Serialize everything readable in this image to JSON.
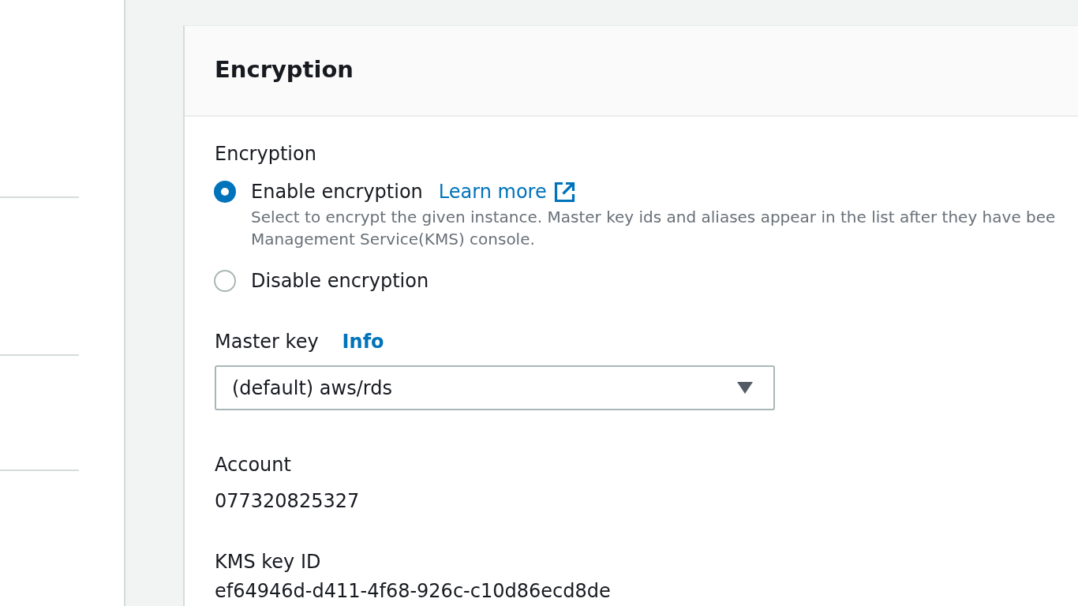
{
  "panel": {
    "title": "Encryption",
    "encryption": {
      "label": "Encryption",
      "options": [
        {
          "label": "Enable encryption",
          "selected": true,
          "link": "Learn more",
          "description_lines": [
            "Select to encrypt the given instance. Master key ids and aliases appear in the list after they have bee",
            "Management Service(KMS) console."
          ]
        },
        {
          "label": "Disable encryption",
          "selected": false
        }
      ]
    },
    "master_key": {
      "label": "Master key",
      "info_link": "Info",
      "value": "(default) aws/rds"
    },
    "details": [
      {
        "label": "Account",
        "value": "077320825327"
      },
      {
        "label": "KMS key ID",
        "value": "ef64946d-d411-4f68-926c-c10d86ecd8de"
      }
    ]
  }
}
